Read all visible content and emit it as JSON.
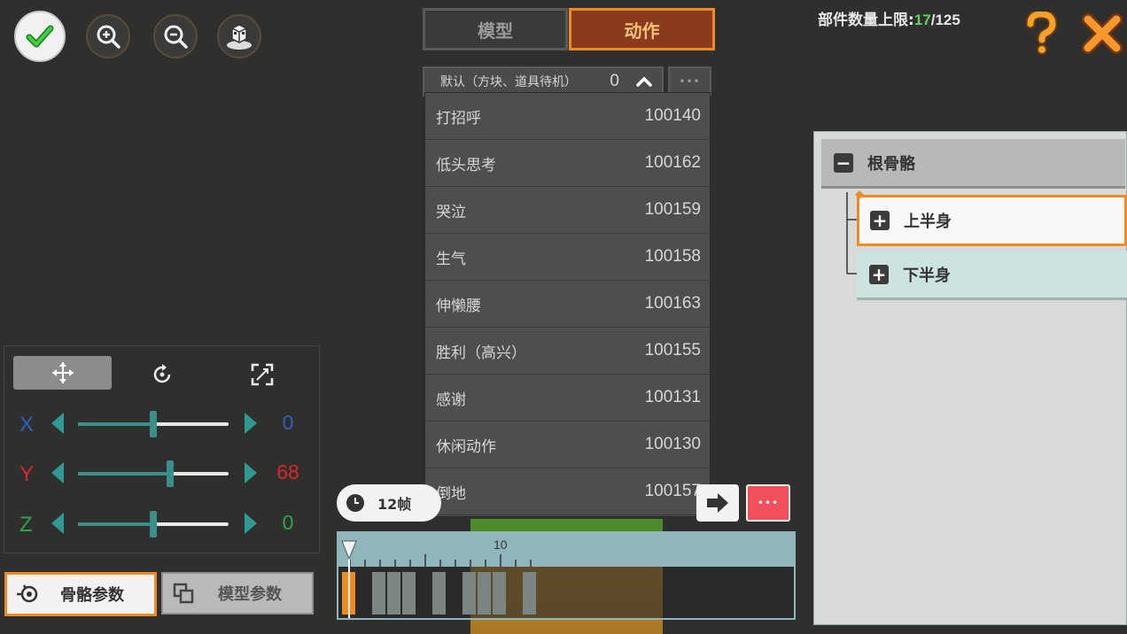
{
  "toolbar": {
    "confirm_icon": "check-icon",
    "zoom_in_icon": "zoom-in-icon",
    "zoom_out_icon": "zoom-out-icon",
    "view_icon": "cube-view-icon"
  },
  "tabs": [
    {
      "label": "模型",
      "active": false
    },
    {
      "label": "动作",
      "active": true
    }
  ],
  "parts_limit": {
    "label": "部件数量上限:",
    "current": "17",
    "max": "/125"
  },
  "dropdown": {
    "selected": "默认（方块、道具待机）",
    "selected_id": "0",
    "more_label": "•••",
    "items": [
      {
        "name": "打招呼",
        "id": "100140"
      },
      {
        "name": "低头思考",
        "id": "100162"
      },
      {
        "name": "哭泣",
        "id": "100159"
      },
      {
        "name": "生气",
        "id": "100158"
      },
      {
        "name": "伸懒腰",
        "id": "100163"
      },
      {
        "name": "胜利（高兴）",
        "id": "100155"
      },
      {
        "name": "感谢",
        "id": "100131"
      },
      {
        "name": "休闲动作",
        "id": "100130"
      },
      {
        "name": "倒地",
        "id": "100157"
      }
    ]
  },
  "transform": {
    "modes": [
      "move-icon",
      "rotate-icon",
      "scale-icon"
    ],
    "axes": [
      {
        "label": "X",
        "value": "0",
        "color": "#2f5fbf",
        "level": 0.5
      },
      {
        "label": "Y",
        "value": "68",
        "color": "#d9262a",
        "level": 0.61
      },
      {
        "label": "Z",
        "value": "0",
        "color": "#2aa84a",
        "level": 0.5
      }
    ]
  },
  "bottom_tabs": {
    "bone_params": "骨骼参数",
    "model_params": "模型参数"
  },
  "timeline": {
    "frames_label": "12帧",
    "tick_label": "10",
    "more_label": "•••"
  },
  "bone_tree": {
    "root": "根骨骼",
    "children": [
      "上半身",
      "下半身"
    ]
  },
  "colors": {
    "accent": "#f08a24",
    "active_tab": "#8a3b1e",
    "panel": "#d8dada"
  }
}
